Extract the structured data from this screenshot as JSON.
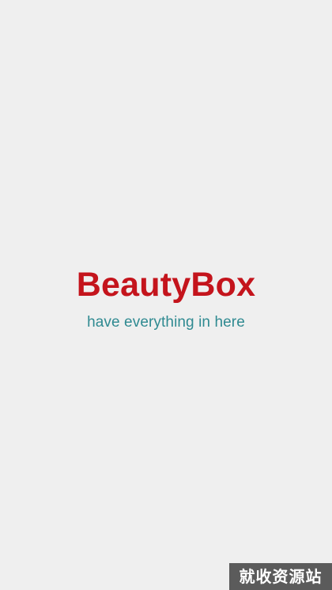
{
  "splash": {
    "title": "BeautyBox",
    "tagline": "have everything in here",
    "title_color": "#c4141c",
    "tagline_color": "#2f8a91",
    "background_color": "#efefef"
  },
  "watermark": {
    "text": "就收资源站",
    "background_color": "#5b5b5b"
  }
}
